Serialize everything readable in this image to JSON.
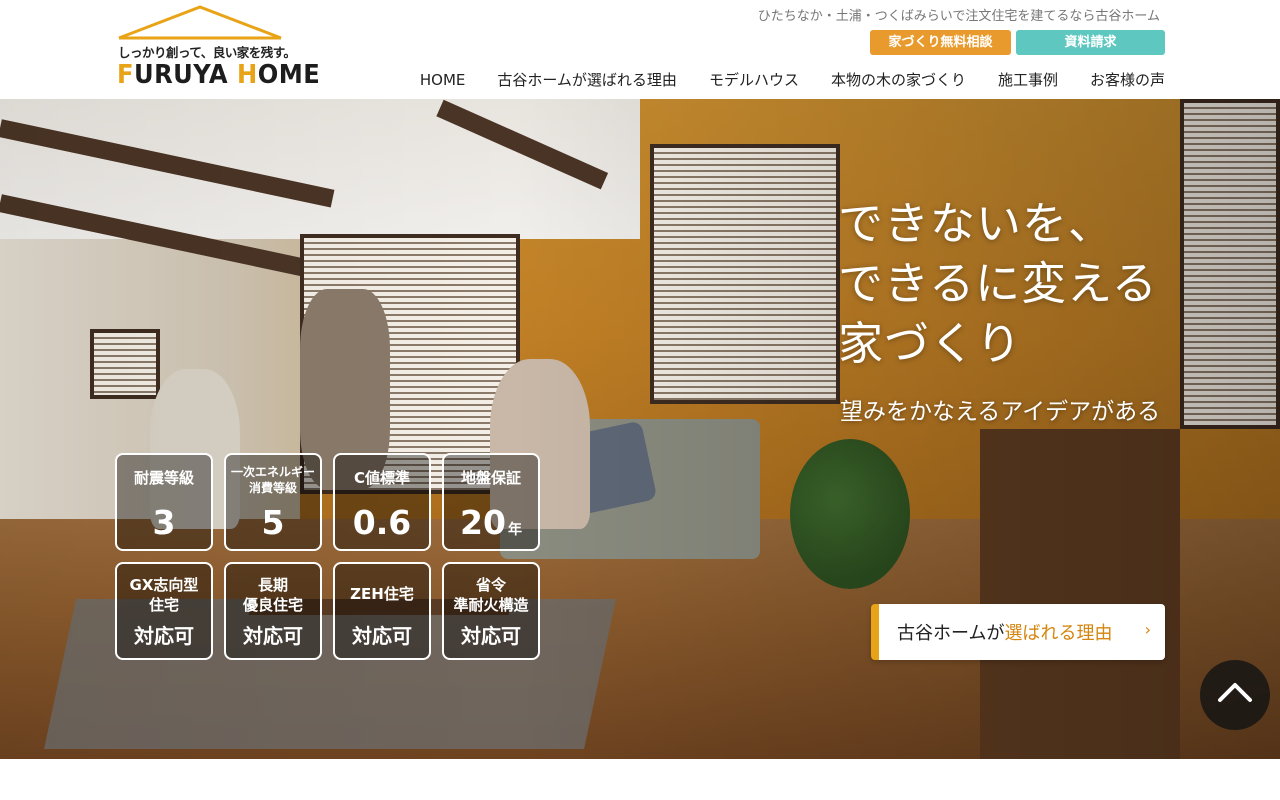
{
  "header": {
    "logo_tagline": "しっかり創って、良い家を残す。",
    "logo_name_parts": [
      "F",
      "URUYA ",
      "H",
      "OME"
    ],
    "tagline": "ひたちなか・土浦・つくばみらいで注文住宅を建てるなら古谷ホーム",
    "cta_consult": "家づくり無料相談",
    "cta_docs": "資料請求",
    "nav": [
      "HOME",
      "古谷ホームが選ばれる理由",
      "モデルハウス",
      "本物の木の家づくり",
      "施工事例",
      "お客様の声"
    ]
  },
  "hero": {
    "headline_lines": [
      "できないを、",
      "できるに変える",
      "家づくり"
    ],
    "subline": "望みをかなえるアイデアがある",
    "badges_top": [
      {
        "title": "耐震等級",
        "value": "3",
        "unit": ""
      },
      {
        "title": "一次エネルギー\n消費等級",
        "value": "5",
        "unit": ""
      },
      {
        "title": "C値標準",
        "value": "0.6",
        "unit": ""
      },
      {
        "title": "地盤保証",
        "value": "20",
        "unit": "年"
      }
    ],
    "badges_bottom": [
      {
        "title": "GX志向型\n住宅",
        "value": "対応可"
      },
      {
        "title": "長期\n優良住宅",
        "value": "対応可"
      },
      {
        "title": "ZEH住宅",
        "value": "対応可"
      },
      {
        "title": "省令\n準耐火構造",
        "value": "対応可"
      }
    ],
    "reason_button": {
      "prefix": "古谷ホームが",
      "accent": "選ばれる理由",
      "arrow": "›"
    }
  },
  "colors": {
    "brand_orange": "#e89a2c",
    "brand_teal": "#5ec7c0",
    "logo_accent": "#e8a317"
  },
  "icons": {
    "to_top": "chevron-up-icon",
    "logo_roof": "roof-icon"
  }
}
